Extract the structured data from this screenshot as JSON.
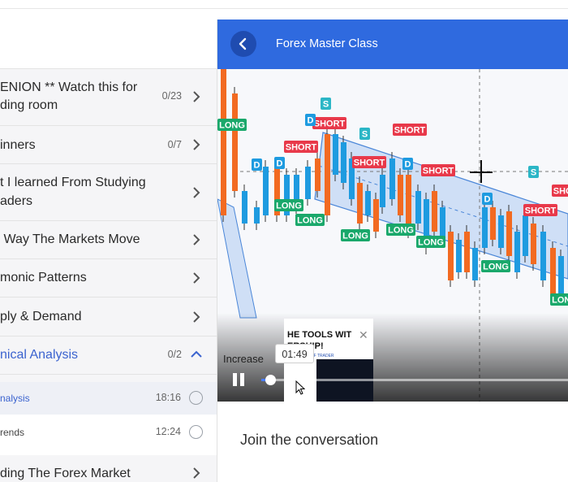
{
  "app": {
    "course_title": "Forex Master Class"
  },
  "sidebar": {
    "sections": [
      {
        "line1": "ENION ** Watch this for",
        "line2": "ding room",
        "count": "0/23"
      },
      {
        "line1": "inners",
        "count": "0/7"
      },
      {
        "line1": "t I learned From Studying",
        "line2": "aders"
      },
      {
        "line1": " Way The Markets Move"
      },
      {
        "line1": "monic Patterns"
      },
      {
        "line1": "ply & Demand"
      },
      {
        "line1": "nical Analysis",
        "count": "0/2"
      },
      {
        "line1": "ding The Forex Market"
      }
    ],
    "lessons": [
      {
        "label": "nalysis",
        "duration": "18:16"
      },
      {
        "label": "rends",
        "duration": "12:24"
      }
    ]
  },
  "video": {
    "overlay_text": "Increase",
    "hover_time": "01:49",
    "progress": 0.03,
    "ad": {
      "line1": "HE TOOLS WIT",
      "line2": "ERSHIP!",
      "line3": "E OF TRADER"
    }
  },
  "chart_labels": {
    "long": "LONG",
    "short": "SHORT",
    "d": "D",
    "s": "S"
  },
  "conversation": {
    "title": "Join the conversation"
  },
  "colors": {
    "accent": "#2f6adf",
    "header_dark": "#1f4cb0",
    "active_text": "#3b63cf",
    "bull_candle": "#1e9be0",
    "bear_candle": "#f26a21",
    "long_badge": "#1aa86b",
    "short_badge": "#e8394a"
  }
}
